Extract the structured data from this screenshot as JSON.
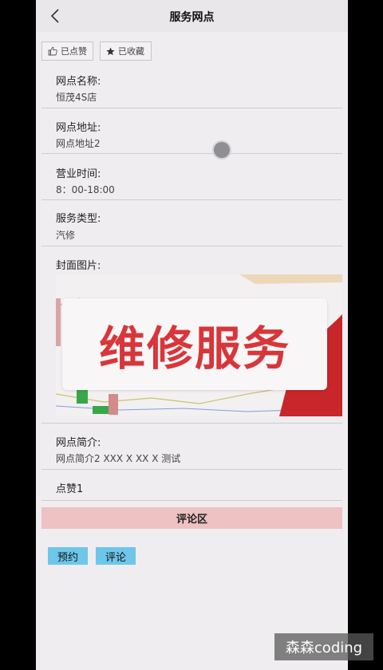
{
  "header": {
    "title": "服务网点"
  },
  "actions": {
    "liked_label": "已点赞",
    "favorited_label": "已收藏"
  },
  "fields": [
    {
      "label": "网点名称:",
      "value": "恒茂4S店"
    },
    {
      "label": "网点地址:",
      "value": "网点地址2"
    },
    {
      "label": "营业时间:",
      "value": "8：00-18:00"
    },
    {
      "label": "服务类型:",
      "value": "汽修"
    }
  ],
  "cover": {
    "label": "封面图片:",
    "banner_text": "维修服务"
  },
  "intro": {
    "label": "网点简介:",
    "value": "网点简介2 XXX X XX X 测试"
  },
  "likes": {
    "text": "点赞1"
  },
  "comments": {
    "title": "评论区"
  },
  "buttons": {
    "book": "预约",
    "comment": "评论"
  },
  "watermark": "森森coding",
  "colors": {
    "section_bar": "#eec1c3",
    "button_blue": "#6ec6ea",
    "banner_red": "#d8363a"
  }
}
